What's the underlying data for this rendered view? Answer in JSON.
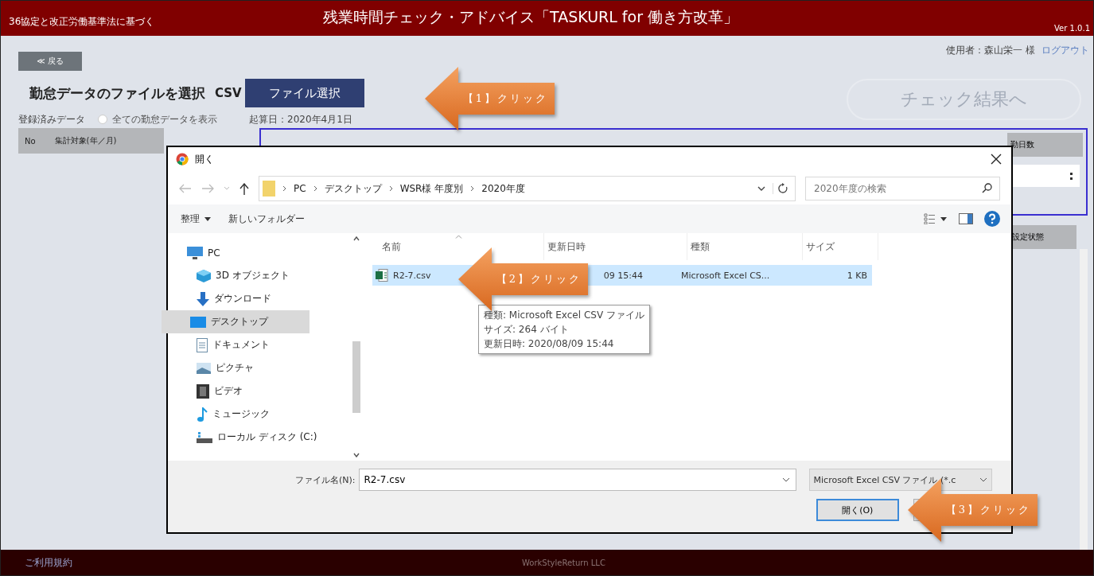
{
  "header": {
    "subtitle": "36協定と改正労働基準法に基づく",
    "title": "残業時間チェック・アドバイス「TASKURL for 働き方改革」",
    "version": "Ver 1.0.1"
  },
  "user": {
    "name": "使用者：森山栄一 様",
    "logout": "ログアウト"
  },
  "back_button": "≪ 戻る",
  "file_section": {
    "label": "勤怠データのファイルを選択",
    "format": "CSV",
    "select_button": "ファイル選択"
  },
  "check_button": "チェック結果へ",
  "registered": {
    "label": "登録済みデータ",
    "option": {
      "label": "全ての勤怠データを表示",
      "checked": false
    }
  },
  "start_date": "起算日：2020年4月1日",
  "table": {
    "columns": [
      "No",
      "集計対象(年／月)"
    ]
  },
  "panel": {
    "column": "勤日数",
    "lower_column": "設定状態"
  },
  "dialog": {
    "title": "開く",
    "path": [
      "PC",
      "デスクトップ",
      "WSR様 年度別",
      "2020年度"
    ],
    "search_placeholder": "2020年度の検索",
    "toolbar": [
      "整理",
      "新しいフォルダー"
    ],
    "nav": [
      {
        "label": "PC",
        "kind": "pc",
        "selected": false
      },
      {
        "label": "3D オブジェクト",
        "kind": "cube",
        "selected": false
      },
      {
        "label": "ダウンロード",
        "kind": "download",
        "selected": false
      },
      {
        "label": "デスクトップ",
        "kind": "desktop",
        "selected": true
      },
      {
        "label": "ドキュメント",
        "kind": "document",
        "selected": false
      },
      {
        "label": "ピクチャ",
        "kind": "picture",
        "selected": false
      },
      {
        "label": "ビデオ",
        "kind": "video",
        "selected": false
      },
      {
        "label": "ミュージック",
        "kind": "music",
        "selected": false
      },
      {
        "label": "ローカル ディスク (C:)",
        "kind": "disk",
        "selected": false
      }
    ],
    "columns": [
      "名前",
      "更新日時",
      "種類",
      "サイズ"
    ],
    "files": [
      {
        "name": "R2-7.csv",
        "date": "09 15:44",
        "type": "Microsoft Excel CS...",
        "size": "1 KB",
        "selected": true
      }
    ],
    "tooltip": [
      "種類: Microsoft Excel CSV ファイル",
      "サイズ: 264 バイト",
      "更新日時: 2020/08/09 15:44"
    ],
    "filename_label": "ファイル名(N):",
    "filename": "R2-7.csv",
    "filter": "Microsoft Excel CSV ファイル (*.c",
    "open_button": "開く(O)"
  },
  "callouts": [
    {
      "text": "【1】クリック"
    },
    {
      "text": "【2】クリック"
    },
    {
      "text": "【3】クリック"
    }
  ],
  "footer": {
    "left": "ご利用規約",
    "center": "WorkStyleReturn LLC"
  }
}
